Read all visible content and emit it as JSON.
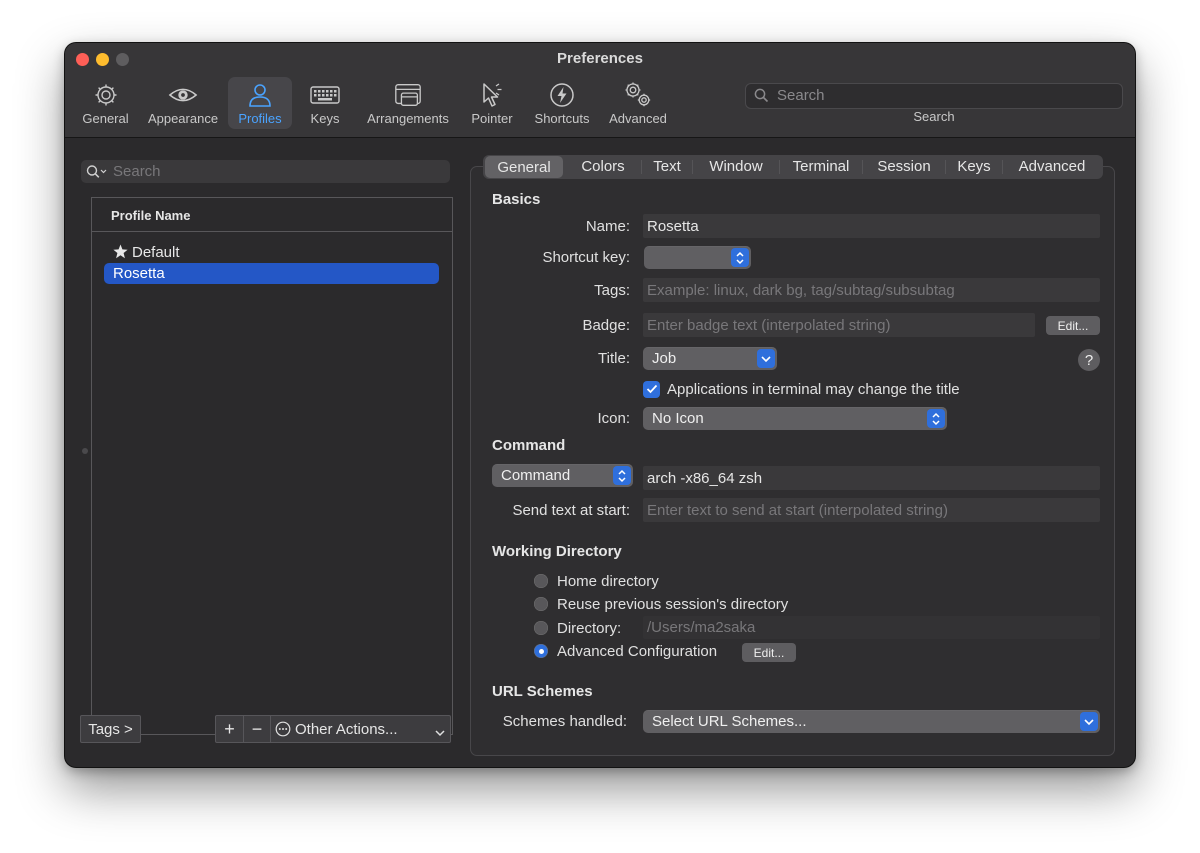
{
  "window": {
    "title": "Preferences"
  },
  "toolbar": {
    "items": [
      {
        "label": "General",
        "icon": "gear-icon"
      },
      {
        "label": "Appearance",
        "icon": "eye-icon"
      },
      {
        "label": "Profiles",
        "icon": "person-icon"
      },
      {
        "label": "Keys",
        "icon": "keyboard-icon"
      },
      {
        "label": "Arrangements",
        "icon": "window-arrangement-icon"
      },
      {
        "label": "Pointer",
        "icon": "pointer-icon"
      },
      {
        "label": "Shortcuts",
        "icon": "lightning-icon"
      },
      {
        "label": "Advanced",
        "icon": "gears-icon"
      }
    ],
    "active": "Profiles",
    "search_placeholder": "Search",
    "search_label": "Search"
  },
  "sidebar": {
    "search_placeholder": "Search",
    "column_header": "Profile Name",
    "profiles": [
      {
        "name": "Default",
        "default": true
      },
      {
        "name": "Rosetta",
        "selected": true
      }
    ],
    "tags_button": "Tags >",
    "add_label": "+",
    "remove_label": "−",
    "other_actions": "Other Actions..."
  },
  "tabs": [
    "General",
    "Colors",
    "Text",
    "Window",
    "Terminal",
    "Session",
    "Keys",
    "Advanced"
  ],
  "selected_tab": "General",
  "basics": {
    "section": "Basics",
    "name_label": "Name:",
    "name_value": "Rosetta",
    "shortcut_label": "Shortcut key:",
    "shortcut_value": "",
    "tags_label": "Tags:",
    "tags_placeholder": "Example: linux, dark bg, tag/subtag/subsubtag",
    "badge_label": "Badge:",
    "badge_placeholder": "Enter badge text (interpolated string)",
    "badge_edit": "Edit...",
    "title_label": "Title:",
    "title_value": "Job",
    "help": "?",
    "apps_change_title": "Applications in terminal may change the title",
    "apps_change_title_checked": true,
    "icon_label": "Icon:",
    "icon_value": "No Icon"
  },
  "command": {
    "section": "Command",
    "mode": "Command",
    "value": "arch -x86_64 zsh",
    "send_text_label": "Send text at start:",
    "send_text_placeholder": "Enter text to send at start (interpolated string)"
  },
  "working_directory": {
    "section": "Working Directory",
    "options": [
      "Home directory",
      "Reuse previous session's directory",
      "Directory:",
      "Advanced Configuration"
    ],
    "selected": "Advanced Configuration",
    "directory_value": "/Users/ma2saka",
    "edit_label": "Edit..."
  },
  "url_schemes": {
    "section": "URL Schemes",
    "label": "Schemes handled:",
    "value": "Select URL Schemes..."
  },
  "colors": {
    "accent": "#2f6fdc",
    "selection": "#2457c6",
    "active_tool": "#4aa3ff",
    "window_bg": "#2b2a2c",
    "close": "#fe5f57",
    "minimize": "#febc2e"
  }
}
